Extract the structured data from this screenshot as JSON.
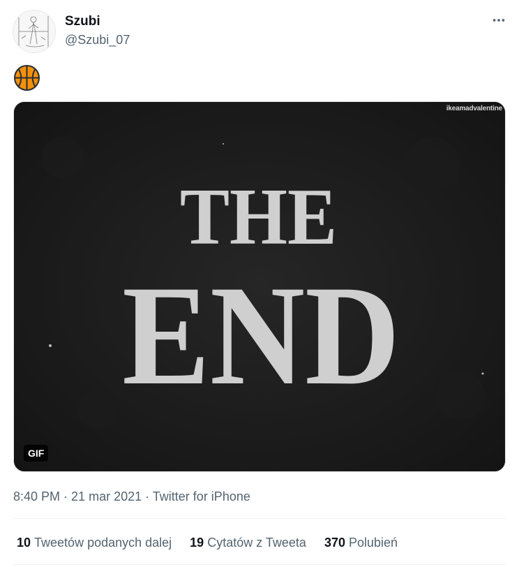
{
  "author": {
    "name": "Szubi",
    "handle": "@Szubi_07"
  },
  "tweet": {
    "text_emoji": "basketball-emoji"
  },
  "media": {
    "type": "gif",
    "badge": "GIF",
    "watermark": "ikeamadvalentine",
    "overlay_text_line1": "THE",
    "overlay_text_line2": "END"
  },
  "meta": {
    "time": "8:40 PM",
    "separator1": " · ",
    "date": "21 mar 2021",
    "separator2": " · ",
    "source": "Twitter for iPhone"
  },
  "stats": [
    {
      "count": "10",
      "label": "Tweetów podanych dalej"
    },
    {
      "count": "19",
      "label": "Cytatów z Tweeta"
    },
    {
      "count": "370",
      "label": "Polubień"
    }
  ],
  "colors": {
    "text_primary": "#0f1419",
    "text_secondary": "#536471",
    "divider": "#eff3f4",
    "basketball": "#f4900c"
  },
  "icons": {
    "more": "more-horizontal-icon",
    "emoji": "basketball-emoji"
  }
}
